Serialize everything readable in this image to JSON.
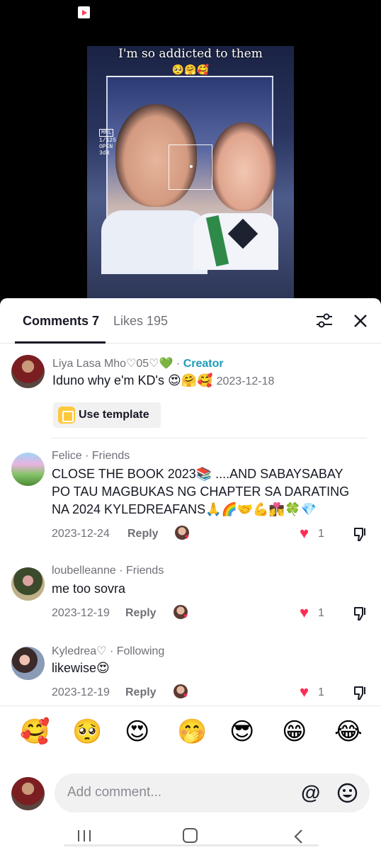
{
  "video": {
    "caption": "I'm so addicted to them",
    "caption_emoji": "🥺🤗🥰",
    "camera_overlay": {
      "mode": "MNL",
      "shutter": "1/125",
      "aperture": "OPEN",
      "gain": "3dB"
    }
  },
  "tabs": {
    "comments": "Comments 7",
    "likes": "Likes 195"
  },
  "comments": [
    {
      "username": "Liya Lasa Mho♡05♡💚",
      "badge": "Creator",
      "text": "Iduno why e'm KD's",
      "emoji": "😍🤗🥰",
      "date": "2023-12-18",
      "template_label": "Use template"
    },
    {
      "username": "Felice",
      "relation": "Friends",
      "text": "CLOSE THE BOOK 2023📚 ....AND SABAYSABAY PO TAU MAGBUKAS NG CHAPTER SA DARATING NA 2024 KYLEDREAFANS🙏🌈🤝💪👩‍❤️‍💋‍👨🍀💎",
      "date": "2023-12-24",
      "reply": "Reply",
      "likes": "1"
    },
    {
      "username": "loubelleanne",
      "relation": "Friends",
      "text": "me too sovra",
      "date": "2023-12-19",
      "reply": "Reply",
      "likes": "1"
    },
    {
      "username": "Kyledrea♡",
      "relation": "Following",
      "text": "likewise😍",
      "date": "2023-12-19",
      "reply": "Reply",
      "likes": "1"
    }
  ],
  "quick_emojis": [
    "🥰",
    "🥺",
    "😍",
    "🤭",
    "😎",
    "😁",
    "😂"
  ],
  "input": {
    "placeholder": "Add comment...",
    "mention_symbol": "@"
  },
  "icons": {
    "status": "video-app-icon",
    "filter": "sliders-icon",
    "close": "close-icon",
    "dislike": "thumbs-down-icon",
    "emoji": "smile-icon"
  },
  "colors": {
    "accent_like": "#fe2c55",
    "creator": "#1d9bb9",
    "template": "#ffc83d"
  }
}
